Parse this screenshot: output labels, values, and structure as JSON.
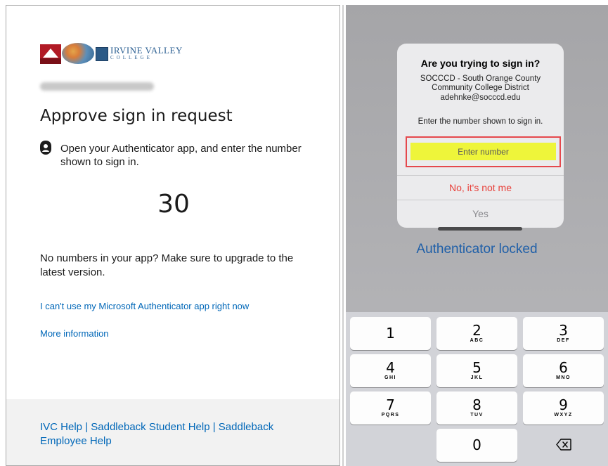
{
  "left_panel": {
    "logo": {
      "college_name": "IRVINE VALLEY",
      "college_sub": "COLLEGE"
    },
    "title": "Approve sign in request",
    "instruction": "Open your Authenticator app, and enter the number shown to sign in.",
    "number": "30",
    "upgrade_notice": "No numbers in your app? Make sure to upgrade to the latest version.",
    "link_cant_use": "I can't use my Microsoft Authenticator app right now",
    "link_more_info": "More information",
    "footer": {
      "ivc_help": "IVC Help",
      "sep1": " | ",
      "saddleback_student_help": "Saddleback Student Help",
      "sep2": " | ",
      "saddleback_employee_help": "Saddleback Employee Help"
    }
  },
  "right_panel": {
    "dialog": {
      "title": "Are you trying to sign in?",
      "organization": "SOCCCD - South Orange County Community College District",
      "email": "adehnke@socccd.edu",
      "prompt": "Enter the number shown to sign in.",
      "input_placeholder": "Enter number",
      "deny_label": "No, it's not me",
      "approve_label": "Yes"
    },
    "status": "Authenticator locked",
    "keypad": {
      "keys": [
        {
          "digit": "1",
          "letters": ""
        },
        {
          "digit": "2",
          "letters": "ABC"
        },
        {
          "digit": "3",
          "letters": "DEF"
        },
        {
          "digit": "4",
          "letters": "GHI"
        },
        {
          "digit": "5",
          "letters": "JKL"
        },
        {
          "digit": "6",
          "letters": "MNO"
        },
        {
          "digit": "7",
          "letters": "PQRS"
        },
        {
          "digit": "8",
          "letters": "TUV"
        },
        {
          "digit": "9",
          "letters": "WXYZ"
        },
        {
          "digit": "0",
          "letters": ""
        }
      ],
      "backspace_icon": "backspace-icon"
    }
  },
  "colors": {
    "link": "#0067b8",
    "deny": "#e8403a",
    "highlight": "#eef53a",
    "highlight_border": "#e5484d",
    "status_text": "#1f5fa8"
  }
}
